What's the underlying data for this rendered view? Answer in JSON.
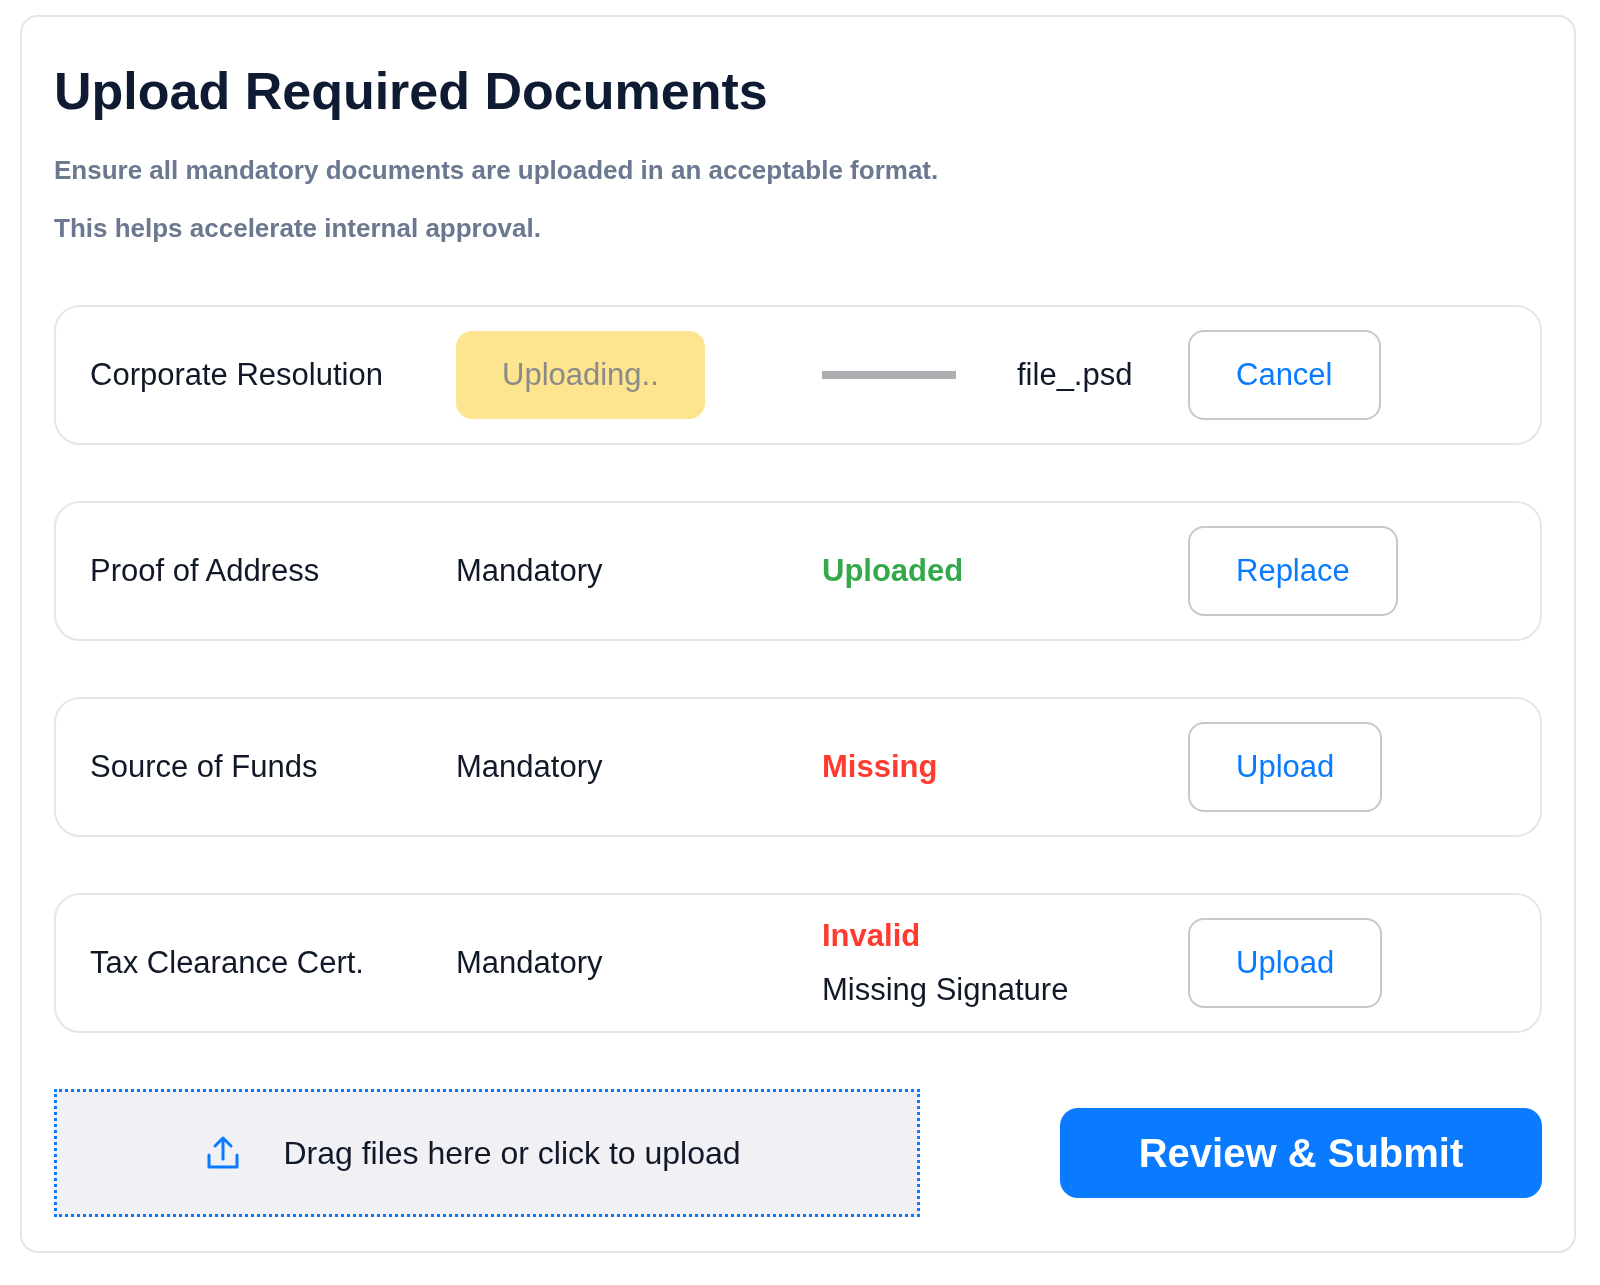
{
  "title": "Upload Required Documents",
  "subtitle_lines": [
    "Ensure all mandatory documents are uploaded in an acceptable format.",
    "This helps accelerate internal approval."
  ],
  "documents": [
    {
      "name": "Corporate Resolution",
      "kind": "uploading",
      "badge": "Uploading..",
      "file": "file_.psd",
      "action": "Cancel"
    },
    {
      "name": "Proof of Address",
      "kind": "status",
      "requirement": "Mandatory",
      "status": "Uploaded",
      "color": "#34a94a",
      "action": "Replace"
    },
    {
      "name": "Source of Funds",
      "kind": "status",
      "requirement": "Mandatory",
      "status": "Missing",
      "color": "#ff3b2f",
      "action": "Upload"
    },
    {
      "name": "Tax Clearance Cert.",
      "kind": "status",
      "requirement": "Mandatory",
      "status": "Invalid",
      "color": "#ff3b2f",
      "detail": "Missing Signature",
      "action": "Upload"
    }
  ],
  "dropzone": {
    "label": "Drag files here or click to upload"
  },
  "submit_button": "Review & Submit"
}
